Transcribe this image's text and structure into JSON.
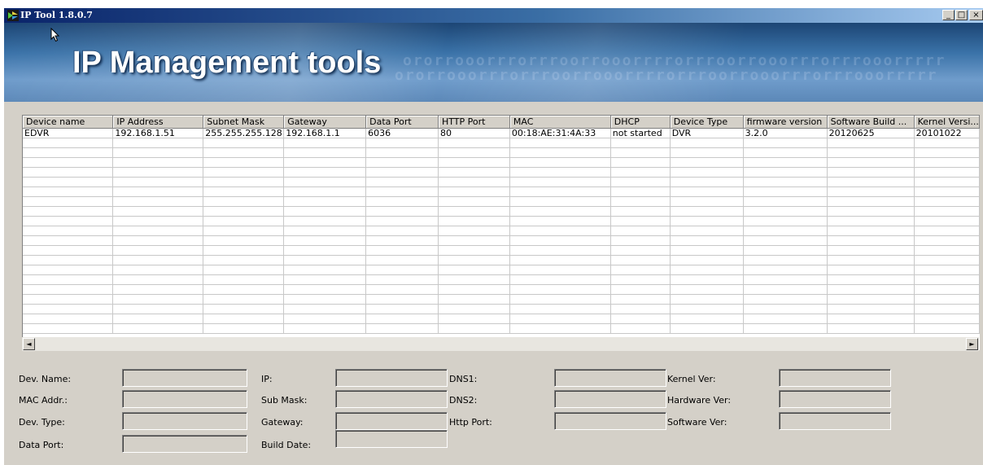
{
  "window": {
    "title": "IP Tool 1.8.0.7",
    "controls": {
      "minimize": "_",
      "maximize": "□",
      "close": "×"
    }
  },
  "banner": {
    "title": "IP Management tools",
    "binary_text": "ororrooorrrorrroorrooorrrrorrroorrooorrrorrrooorrrrr"
  },
  "table": {
    "columns": [
      "Device name",
      "IP Address",
      "Subnet Mask",
      "Gateway",
      "Data Port",
      "HTTP Port",
      "MAC",
      "DHCP",
      "Device Type",
      "firmware version",
      "Software Build ...",
      "Kernel Versi..."
    ],
    "rows": [
      [
        "EDVR",
        "192.168.1.51",
        "255.255.255.128",
        "192.168.1.1",
        "6036",
        "80",
        "00:18:AE:31:4A:33",
        "not started",
        "DVR",
        "3.2.0",
        "20120625",
        "20101022"
      ]
    ]
  },
  "scrollbar": {
    "left_arrow": "◄",
    "right_arrow": "►"
  },
  "details": {
    "dev_name": {
      "label": "Dev. Name:",
      "value": ""
    },
    "mac_addr": {
      "label": "MAC Addr.:",
      "value": ""
    },
    "dev_type": {
      "label": "Dev. Type:",
      "value": ""
    },
    "data_port": {
      "label": "Data Port:",
      "value": ""
    },
    "ip": {
      "label": "IP:",
      "value": ""
    },
    "sub_mask": {
      "label": "Sub Mask:",
      "value": ""
    },
    "gateway": {
      "label": "Gateway:",
      "value": ""
    },
    "build_date": {
      "label": "Build Date:",
      "value": ""
    },
    "dns1": {
      "label": "DNS1:",
      "value": ""
    },
    "dns2": {
      "label": "DNS2:",
      "value": ""
    },
    "http_port": {
      "label": "Http Port:",
      "value": ""
    },
    "kernel_ver": {
      "label": "Kernel Ver:",
      "value": ""
    },
    "hardware_ver": {
      "label": "Hardware Ver:",
      "value": ""
    },
    "software_ver": {
      "label": "Software Ver:",
      "value": ""
    }
  },
  "colors": {
    "title_bar": "#0a246a",
    "window_face": "#d4d0c8",
    "banner": "#3a72a8"
  }
}
